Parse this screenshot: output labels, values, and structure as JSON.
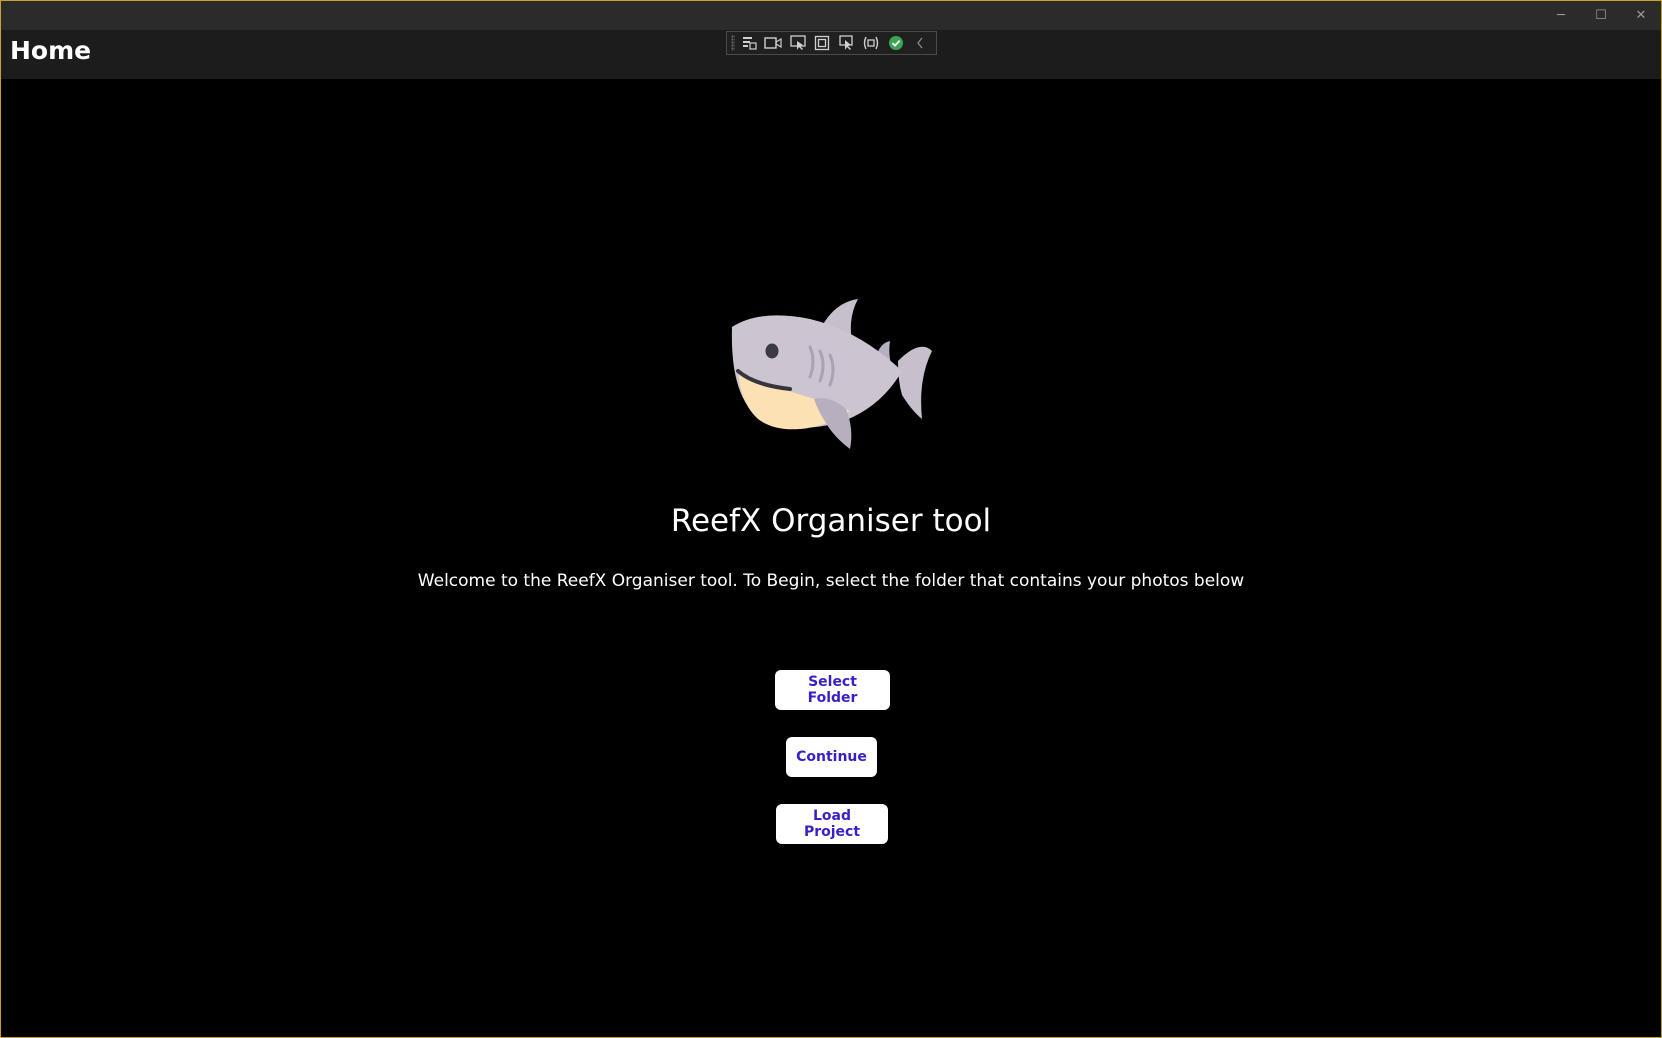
{
  "window": {
    "minimize_glyph": "─",
    "maximize_glyph": "☐",
    "close_glyph": "✕"
  },
  "header": {
    "title": "Home"
  },
  "debug_toolbar": {
    "icons": [
      "live-visual-tree-icon",
      "video-capture-icon",
      "select-element-icon",
      "display-layout-adorners-icon",
      "track-focused-element-icon",
      "binding-failures-icon",
      "hot-reload-ok-icon",
      "collapse-chevron-icon"
    ]
  },
  "main": {
    "logo_icon": "shark-icon",
    "app_title": "ReefX Organiser tool",
    "welcome_text": "Welcome to the ReefX Organiser tool. To Begin, select the folder that contains your photos below",
    "buttons": {
      "select_folder": "Select Folder",
      "continue": "Continue",
      "load_project": "Load Project"
    }
  },
  "colors": {
    "window_border": "#c9a227",
    "titlebar": "#2b2b2b",
    "header": "#1c1c1c",
    "background": "#000000",
    "button_bg": "#ffffff",
    "button_text": "#3a1fc8"
  }
}
